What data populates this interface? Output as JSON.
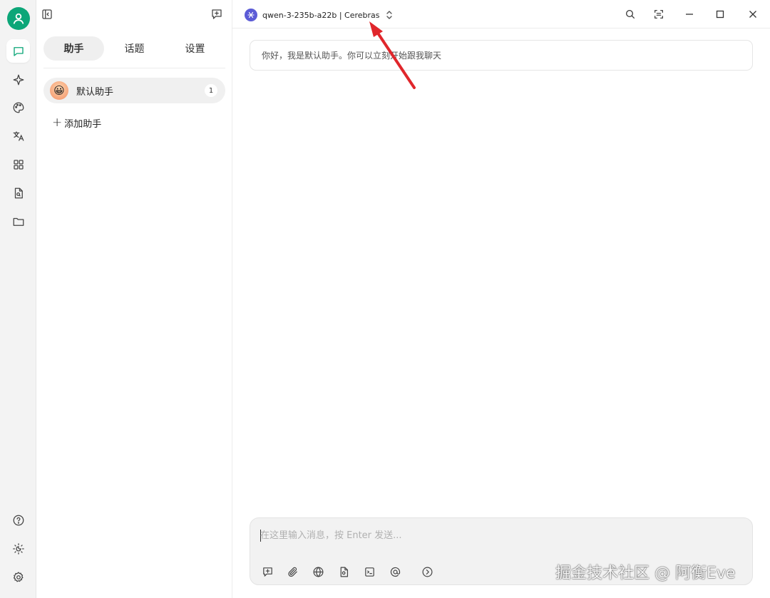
{
  "sidebar": {
    "tabs": [
      {
        "label": "助手",
        "active": true
      },
      {
        "label": "话题",
        "active": false
      },
      {
        "label": "设置",
        "active": false
      }
    ],
    "assistants": [
      {
        "name": "默认助手",
        "count": "1"
      }
    ],
    "add_assistant_label": "添加助手"
  },
  "topbar": {
    "model_label": "qwen-3-235b-a22b | Cerebras"
  },
  "chat": {
    "welcome_message": "你好，我是默认助手。你可以立刻开始跟我聊天"
  },
  "composer": {
    "placeholder": "在这里输入消息，按 Enter 发送..."
  },
  "watermark": "掘金技术社区 @ 阿衡Eve",
  "colors": {
    "accent": "#0ca678",
    "model_logo": "#5b5bd6",
    "annotation_arrow": "#e0262b"
  },
  "icons": {
    "rail": [
      "user-icon",
      "chat-icon",
      "sparkle-icon",
      "palette-icon",
      "translate-icon",
      "apps-icon",
      "file-search-icon",
      "folder-icon",
      "help-icon",
      "theme-icon",
      "settings-icon"
    ],
    "composer_toolbar": [
      "new-topic-icon",
      "attachment-icon",
      "globe-icon",
      "knowledge-icon",
      "terminal-icon",
      "mention-icon",
      "expand-icon"
    ]
  }
}
